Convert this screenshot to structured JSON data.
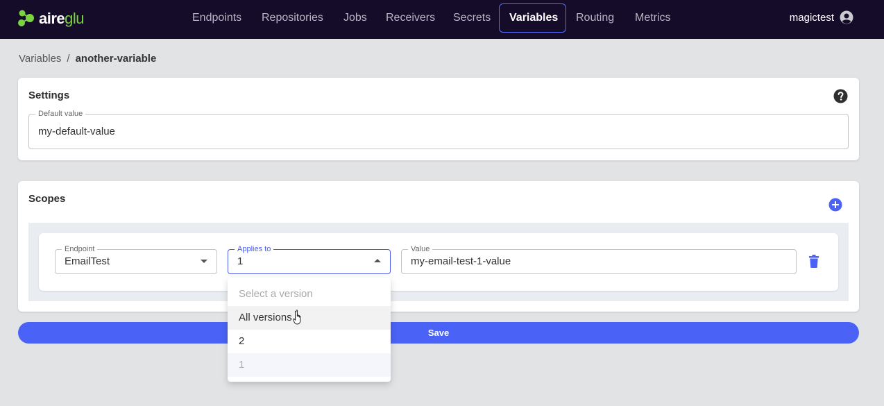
{
  "brand": {
    "name_primary": "aire",
    "name_accent": "glu",
    "accent_color": "#7bd33f"
  },
  "nav": {
    "items": [
      {
        "label": "Endpoints",
        "active": false
      },
      {
        "label": "Repositories",
        "active": false
      },
      {
        "label": "Jobs",
        "active": false
      },
      {
        "label": "Receivers",
        "active": false
      },
      {
        "label": "Secrets",
        "active": false
      },
      {
        "label": "Variables",
        "active": true
      },
      {
        "label": "Routing",
        "active": false
      },
      {
        "label": "Metrics",
        "active": false
      }
    ],
    "user": "magictest"
  },
  "breadcrumb": {
    "parent": "Variables",
    "separator": "/",
    "current": "another-variable"
  },
  "settings": {
    "title": "Settings",
    "default_value_label": "Default value",
    "default_value": "my-default-value"
  },
  "scopes": {
    "title": "Scopes",
    "row": {
      "endpoint_label": "Endpoint",
      "endpoint_value": "EmailTest",
      "applies_label": "Applies to",
      "applies_value": "1",
      "value_label": "Value",
      "value_value": "my-email-test-1-value"
    }
  },
  "save_label": "Save",
  "dropdown": {
    "placeholder": "Select a version",
    "options": [
      "All versions",
      "2",
      "1"
    ]
  },
  "colors": {
    "primary": "#4a63f6",
    "navbar": "#150c2a"
  }
}
